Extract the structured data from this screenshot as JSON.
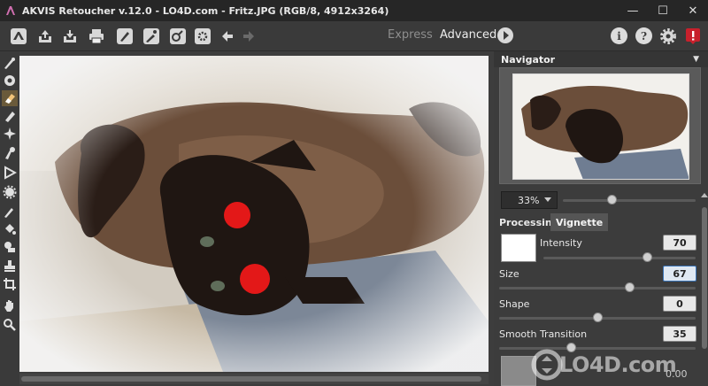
{
  "window": {
    "title": "AKVIS Retoucher v.12.0 - LO4D.com - Fritz.JPG (RGB/8, 4912x3264)",
    "controls": [
      "minimize-icon",
      "maximize-icon",
      "close-icon"
    ]
  },
  "toolbar": {
    "buttons": [
      "home-icon",
      "open-icon",
      "save-icon",
      "print-icon",
      "brush-pen-icon",
      "wand-brush-icon",
      "settings-brush-icon",
      "gear-cog-icon",
      "back-arrow-icon",
      "forward-arrow-icon"
    ],
    "mode_express": "Express",
    "mode_advanced": "Advanced",
    "run_icon": "play-icon",
    "info_label": "i",
    "help_label": "?",
    "prefs_icon": "gear-icon",
    "alert_icon": "alert-icon"
  },
  "tools": [
    "retouch-brush-icon",
    "patch-icon",
    "eraser-icon",
    "chisel-icon",
    "star-burst-icon",
    "smudge-icon",
    "triangle-play-icon",
    "gear-spot-icon",
    "brush-icon",
    "paint-bucket-icon",
    "clone-stamp-icon",
    "stamp-icon",
    "crop-icon",
    "hand-icon",
    "zoom-icon"
  ],
  "navigator": {
    "title": "Navigator",
    "zoom": "33%"
  },
  "tabs": {
    "processing": "Processing",
    "vignette": "Vignette"
  },
  "params": {
    "intensity_label": "Intensity",
    "intensity_value": "70",
    "size_label": "Size",
    "size_value": "67",
    "shape_label": "Shape",
    "shape_value": "0",
    "smooth_label": "Smooth Transition",
    "smooth_value": "35",
    "extra_value": "0.00"
  },
  "colors": {
    "vignette_color": "#ffffff",
    "markers": "#e31818"
  },
  "watermark": {
    "text": "LO4D.com"
  }
}
